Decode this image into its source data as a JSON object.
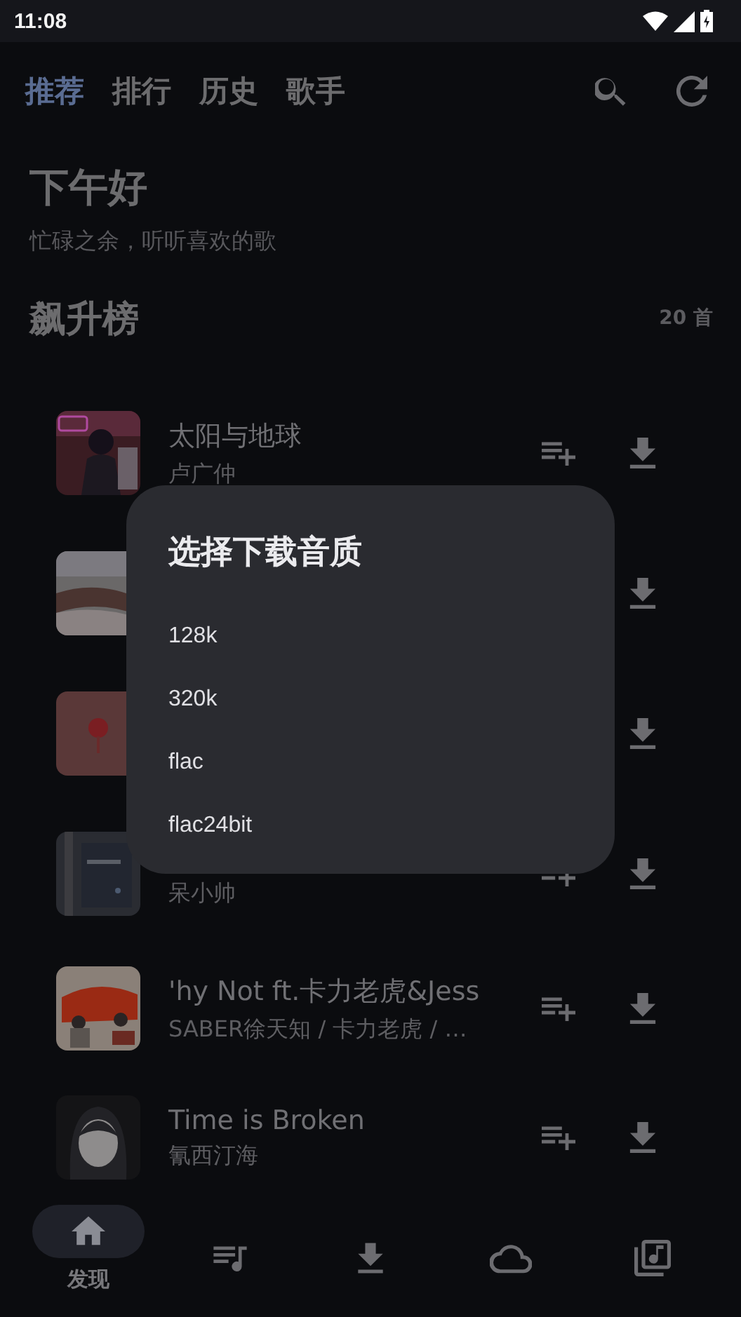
{
  "status_bar": {
    "time": "11:08"
  },
  "tabs": [
    {
      "label": "推荐",
      "selected": true
    },
    {
      "label": "排行",
      "selected": false
    },
    {
      "label": "历史",
      "selected": false
    },
    {
      "label": "歌手",
      "selected": false
    }
  ],
  "greeting": {
    "title": "下午好",
    "subtitle": "忙碌之余，听听喜欢的歌"
  },
  "section": {
    "title": "飙升榜",
    "count": "20 首"
  },
  "songs": [
    {
      "kind": "full",
      "title": "太阳与地球",
      "artist": "卢广仲"
    },
    {
      "kind": "covered"
    },
    {
      "kind": "covered"
    },
    {
      "kind": "full",
      "artist": "呆小帅"
    },
    {
      "kind": "full",
      "title": "'hy Not ft.卡力老虎&Jess",
      "artist": "SABER徐天知 / 卡力老虎 / …"
    },
    {
      "kind": "full",
      "title": "Time is Broken",
      "artist": "氰西汀海"
    }
  ],
  "dialog": {
    "title": "选择下载音质",
    "options": [
      "128k",
      "320k",
      "flac",
      "flac24bit"
    ]
  },
  "bottom_nav": [
    {
      "kind": "home",
      "label": "发现",
      "selected": true
    },
    {
      "kind": "queue",
      "selected": false
    },
    {
      "kind": "download",
      "selected": false
    },
    {
      "kind": "cloud",
      "selected": false
    },
    {
      "kind": "library",
      "selected": false
    }
  ]
}
